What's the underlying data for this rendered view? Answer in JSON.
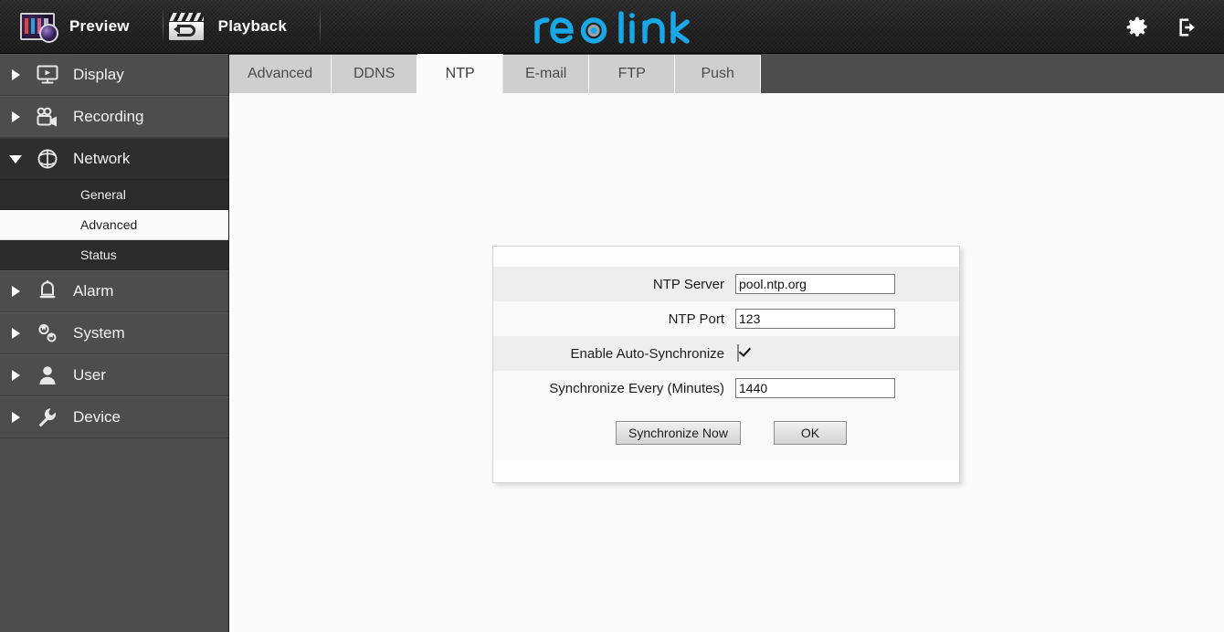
{
  "header": {
    "nav": [
      {
        "label": "Preview",
        "icon": "preview-monitor-icon"
      },
      {
        "label": "Playback",
        "icon": "playback-clapperboard-icon"
      }
    ],
    "brand": "reolink",
    "brand_color": "#18a8e8",
    "actions": [
      {
        "name": "settings-button",
        "icon": "gear-icon"
      },
      {
        "name": "logout-button",
        "icon": "logout-icon"
      }
    ]
  },
  "sidebar": {
    "items": [
      {
        "label": "Display",
        "icon": "monitor-icon",
        "expanded": false
      },
      {
        "label": "Recording",
        "icon": "camcorder-icon",
        "expanded": false
      },
      {
        "label": "Network",
        "icon": "globe-icon",
        "expanded": true,
        "children": [
          {
            "label": "General",
            "active": false
          },
          {
            "label": "Advanced",
            "active": true
          },
          {
            "label": "Status",
            "active": false
          }
        ]
      },
      {
        "label": "Alarm",
        "icon": "bell-icon",
        "expanded": false
      },
      {
        "label": "System",
        "icon": "gears-icon",
        "expanded": false
      },
      {
        "label": "User",
        "icon": "person-icon",
        "expanded": false
      },
      {
        "label": "Device",
        "icon": "wrench-icon",
        "expanded": false
      }
    ]
  },
  "tabs": [
    {
      "label": "Advanced",
      "active": false
    },
    {
      "label": "DDNS",
      "active": false
    },
    {
      "label": "NTP",
      "active": true
    },
    {
      "label": "E-mail",
      "active": false
    },
    {
      "label": "FTP",
      "active": false
    },
    {
      "label": "Push",
      "active": false
    }
  ],
  "form": {
    "fields": [
      {
        "label": "NTP Server",
        "type": "text",
        "value": "pool.ntp.org"
      },
      {
        "label": "NTP Port",
        "type": "text",
        "value": "123"
      },
      {
        "label": "Enable Auto-Synchronize",
        "type": "checkbox",
        "checked": true
      },
      {
        "label": "Synchronize Every (Minutes)",
        "type": "text",
        "value": "1440"
      }
    ],
    "buttons": [
      {
        "label": "Synchronize Now"
      },
      {
        "label": "OK"
      }
    ]
  }
}
